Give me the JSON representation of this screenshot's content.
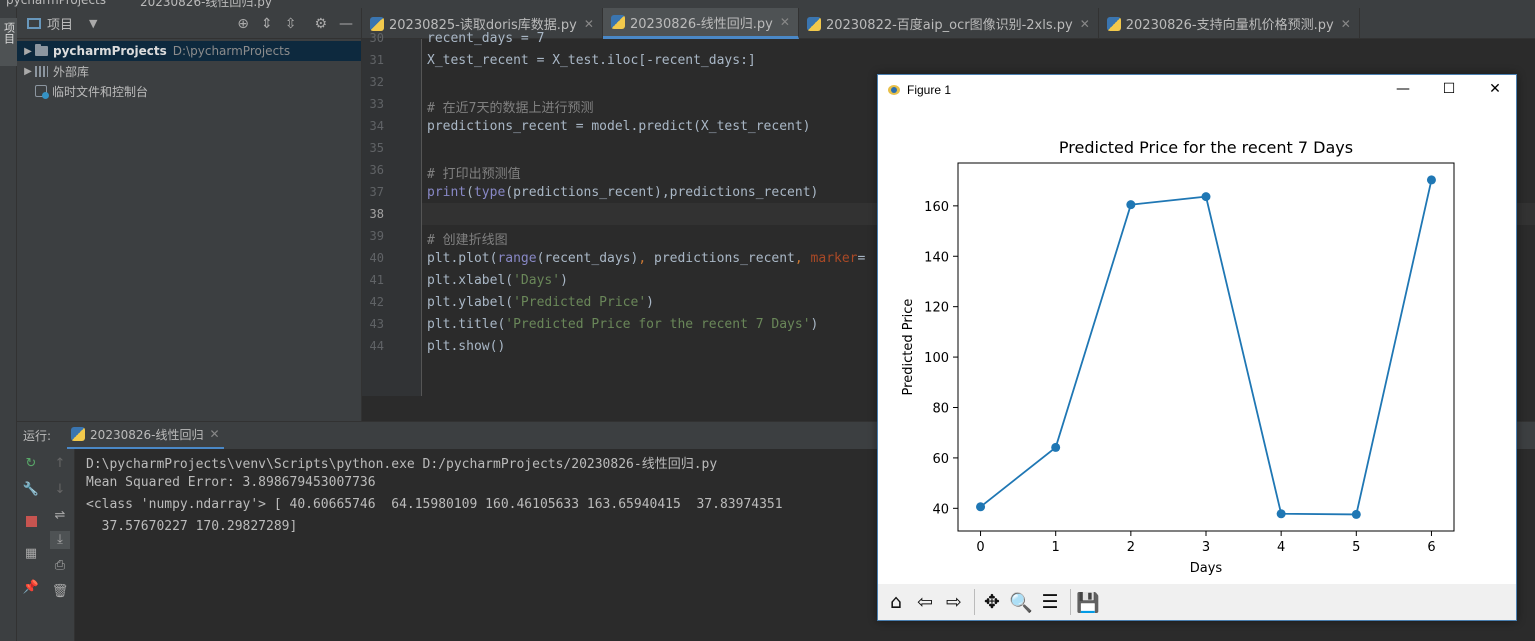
{
  "window": {
    "title_left": "pycharmProjects",
    "title_file": "20230826-线性回归.py"
  },
  "left_strip": {
    "project_tab": "项目"
  },
  "project_panel": {
    "title": "项目",
    "tree": [
      {
        "name": "pycharmProjects",
        "path": "D:\\pycharmProjects",
        "expanded": false,
        "selected": true
      },
      {
        "name": "外部库"
      },
      {
        "name": "临时文件和控制台"
      }
    ]
  },
  "tabs": [
    {
      "label": "20230825-读取doris库数据.py",
      "active": false
    },
    {
      "label": "20230826-线性回归.py",
      "active": true
    },
    {
      "label": "20230822-百度aip_ocr图像识别-2xls.py",
      "active": false
    },
    {
      "label": "20230826-支持向量机价格预测.py",
      "active": false
    }
  ],
  "editor": {
    "lines": [
      {
        "n": "30",
        "text": "recent_days = 7"
      },
      {
        "n": "31",
        "text": "X_test_recent = X_test.iloc[-recent_days:]"
      },
      {
        "n": "32",
        "text": ""
      },
      {
        "n": "33",
        "text": "# 在近7天的数据上进行预测"
      },
      {
        "n": "34",
        "text": "predictions_recent = model.predict(X_test_recent)"
      },
      {
        "n": "35",
        "text": ""
      },
      {
        "n": "36",
        "text": "# 打印出预测值"
      },
      {
        "n": "37",
        "text": "print(type(predictions_recent),predictions_recent)"
      },
      {
        "n": "38",
        "text": ""
      },
      {
        "n": "39",
        "text": "# 创建折线图"
      },
      {
        "n": "40",
        "text": "plt.plot(range(recent_days), predictions_recent, marker="
      },
      {
        "n": "41",
        "text": "plt.xlabel('Days')"
      },
      {
        "n": "42",
        "text": "plt.ylabel('Predicted Price')"
      },
      {
        "n": "43",
        "text": "plt.title('Predicted Price for the recent 7 Days')"
      },
      {
        "n": "44",
        "text": "plt.show()"
      }
    ]
  },
  "run_panel": {
    "label": "运行:",
    "tab_label": "20230826-线性回归",
    "console": [
      "D:\\pycharmProjects\\venv\\Scripts\\python.exe D:/pycharmProjects/20230826-线性回归.py",
      "Mean Squared Error: 3.898679453007736",
      "<class 'numpy.ndarray'> [ 40.60665746  64.15980109 160.46105633 163.65940415  37.83974351",
      "  37.57670227 170.29827289]"
    ]
  },
  "figure": {
    "window_title": "Figure 1",
    "toolbar": [
      "home-icon",
      "back-icon",
      "forward-icon",
      "pan-icon",
      "zoom-icon",
      "configure-icon",
      "save-icon"
    ]
  },
  "chart_data": {
    "type": "line",
    "title": "Predicted Price for the recent 7 Days",
    "xlabel": "Days",
    "ylabel": "Predicted Price",
    "x": [
      0,
      1,
      2,
      3,
      4,
      5,
      6
    ],
    "y": [
      40.60665746,
      64.15980109,
      160.46105633,
      163.65940415,
      37.83974351,
      37.57670227,
      170.29827289
    ],
    "xticks": [
      "0",
      "1",
      "2",
      "3",
      "4",
      "5",
      "6"
    ],
    "yticks": [
      "40",
      "60",
      "80",
      "100",
      "120",
      "140",
      "160"
    ],
    "xlim": [
      -0.3,
      6.3
    ],
    "ylim": [
      31.0,
      177.0
    ],
    "marker": "o",
    "color": "#1f77b4",
    "grid": false
  }
}
